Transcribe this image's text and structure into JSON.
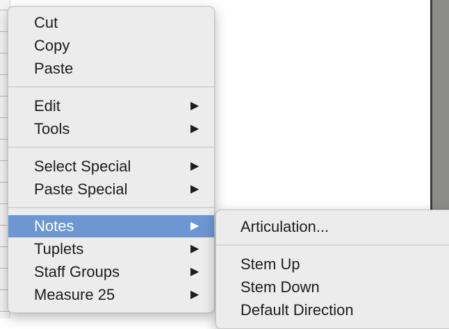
{
  "context_menu": {
    "groups": [
      [
        {
          "label": "Cut",
          "submenu": false
        },
        {
          "label": "Copy",
          "submenu": false
        },
        {
          "label": "Paste",
          "submenu": false
        }
      ],
      [
        {
          "label": "Edit",
          "submenu": true
        },
        {
          "label": "Tools",
          "submenu": true
        }
      ],
      [
        {
          "label": "Select Special",
          "submenu": true
        },
        {
          "label": "Paste Special",
          "submenu": true
        }
      ],
      [
        {
          "label": "Notes",
          "submenu": true,
          "highlighted": true
        },
        {
          "label": "Tuplets",
          "submenu": true
        },
        {
          "label": "Staff Groups",
          "submenu": true
        },
        {
          "label": "Measure 25",
          "submenu": true
        }
      ]
    ],
    "submenu_arrow": "▶"
  },
  "notes_submenu": {
    "groups": [
      [
        {
          "label": "Articulation..."
        }
      ],
      [
        {
          "label": "Stem Up"
        },
        {
          "label": "Stem Down"
        },
        {
          "label": "Default Direction"
        }
      ]
    ]
  },
  "colors": {
    "highlight": "#6c97d3",
    "menu_background": "#ececec",
    "text": "#1c1c1c"
  },
  "icons": {
    "submenu_indicator": "submenu-arrow-icon"
  }
}
